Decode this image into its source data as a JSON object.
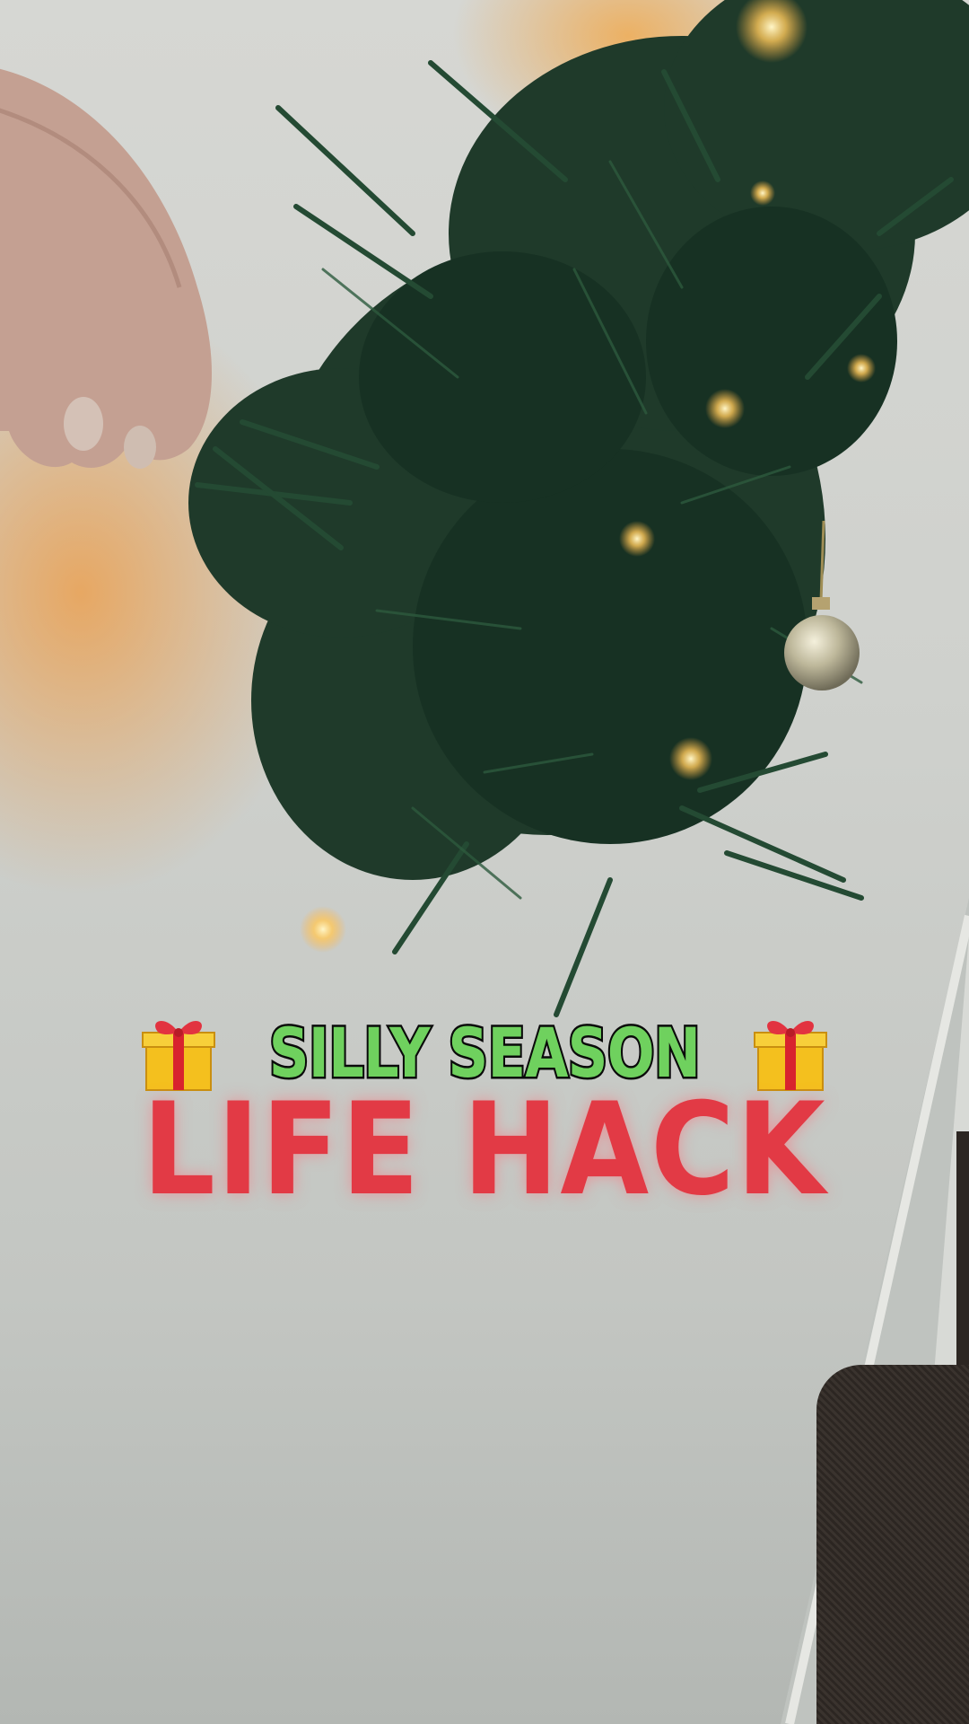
{
  "overlay": {
    "title": "SILLY SEASON",
    "subtitle": "LIFE HACK",
    "left_icon": "gift-icon",
    "right_icon": "gift-icon"
  },
  "colors": {
    "title_fill": "#6fd15e",
    "title_outline": "#0a0a0a",
    "subtitle_fill": "#e23a45"
  }
}
